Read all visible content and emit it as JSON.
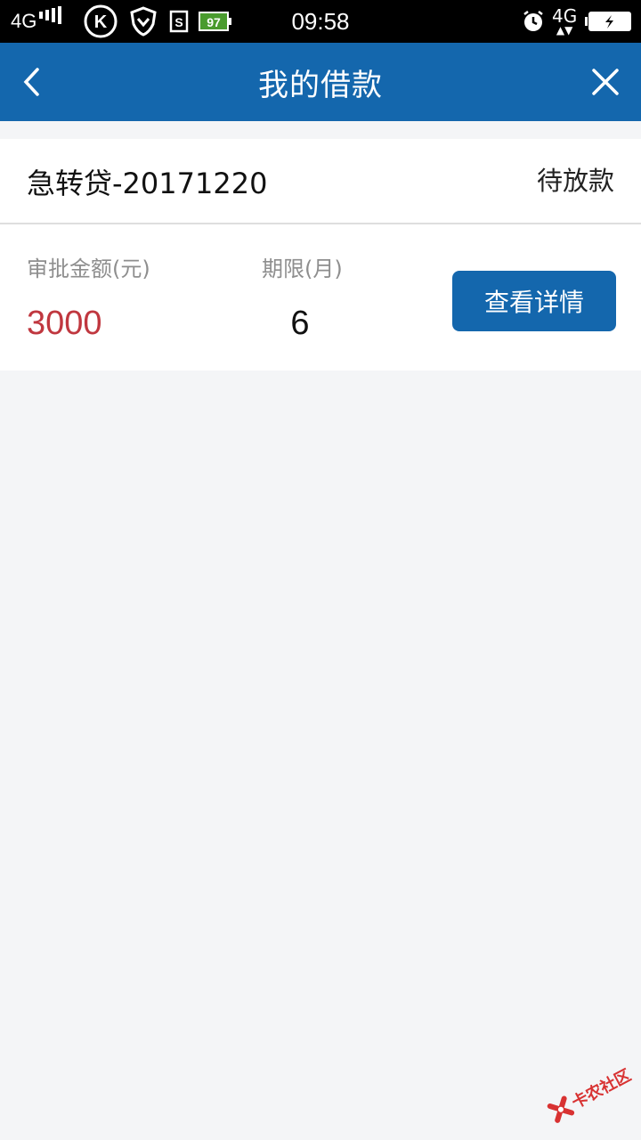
{
  "status_bar": {
    "network_left": "4G",
    "k_app_letter": "K",
    "sim_letter": "S",
    "battery_app_level": "97",
    "time": "09:58",
    "network_right": "4G",
    "icons": [
      "signal-icon",
      "k-app-icon",
      "shield-icon",
      "sim-icon",
      "battery-app-icon",
      "alarm-icon",
      "data-arrows-icon",
      "battery-icon"
    ]
  },
  "header": {
    "title": "我的借款",
    "back_icon": "chevron-left-icon",
    "close_icon": "close-icon",
    "background": "#1467ad"
  },
  "loan": {
    "name": "急转贷-20171220",
    "status": "待放款",
    "amount_label": "审批金额(元)",
    "amount_value": "3000",
    "term_label": "期限(月)",
    "term_value": "6",
    "detail_button_label": "查看详情",
    "amount_color": "#c0373f"
  },
  "watermark": {
    "text": "卡农社区"
  }
}
